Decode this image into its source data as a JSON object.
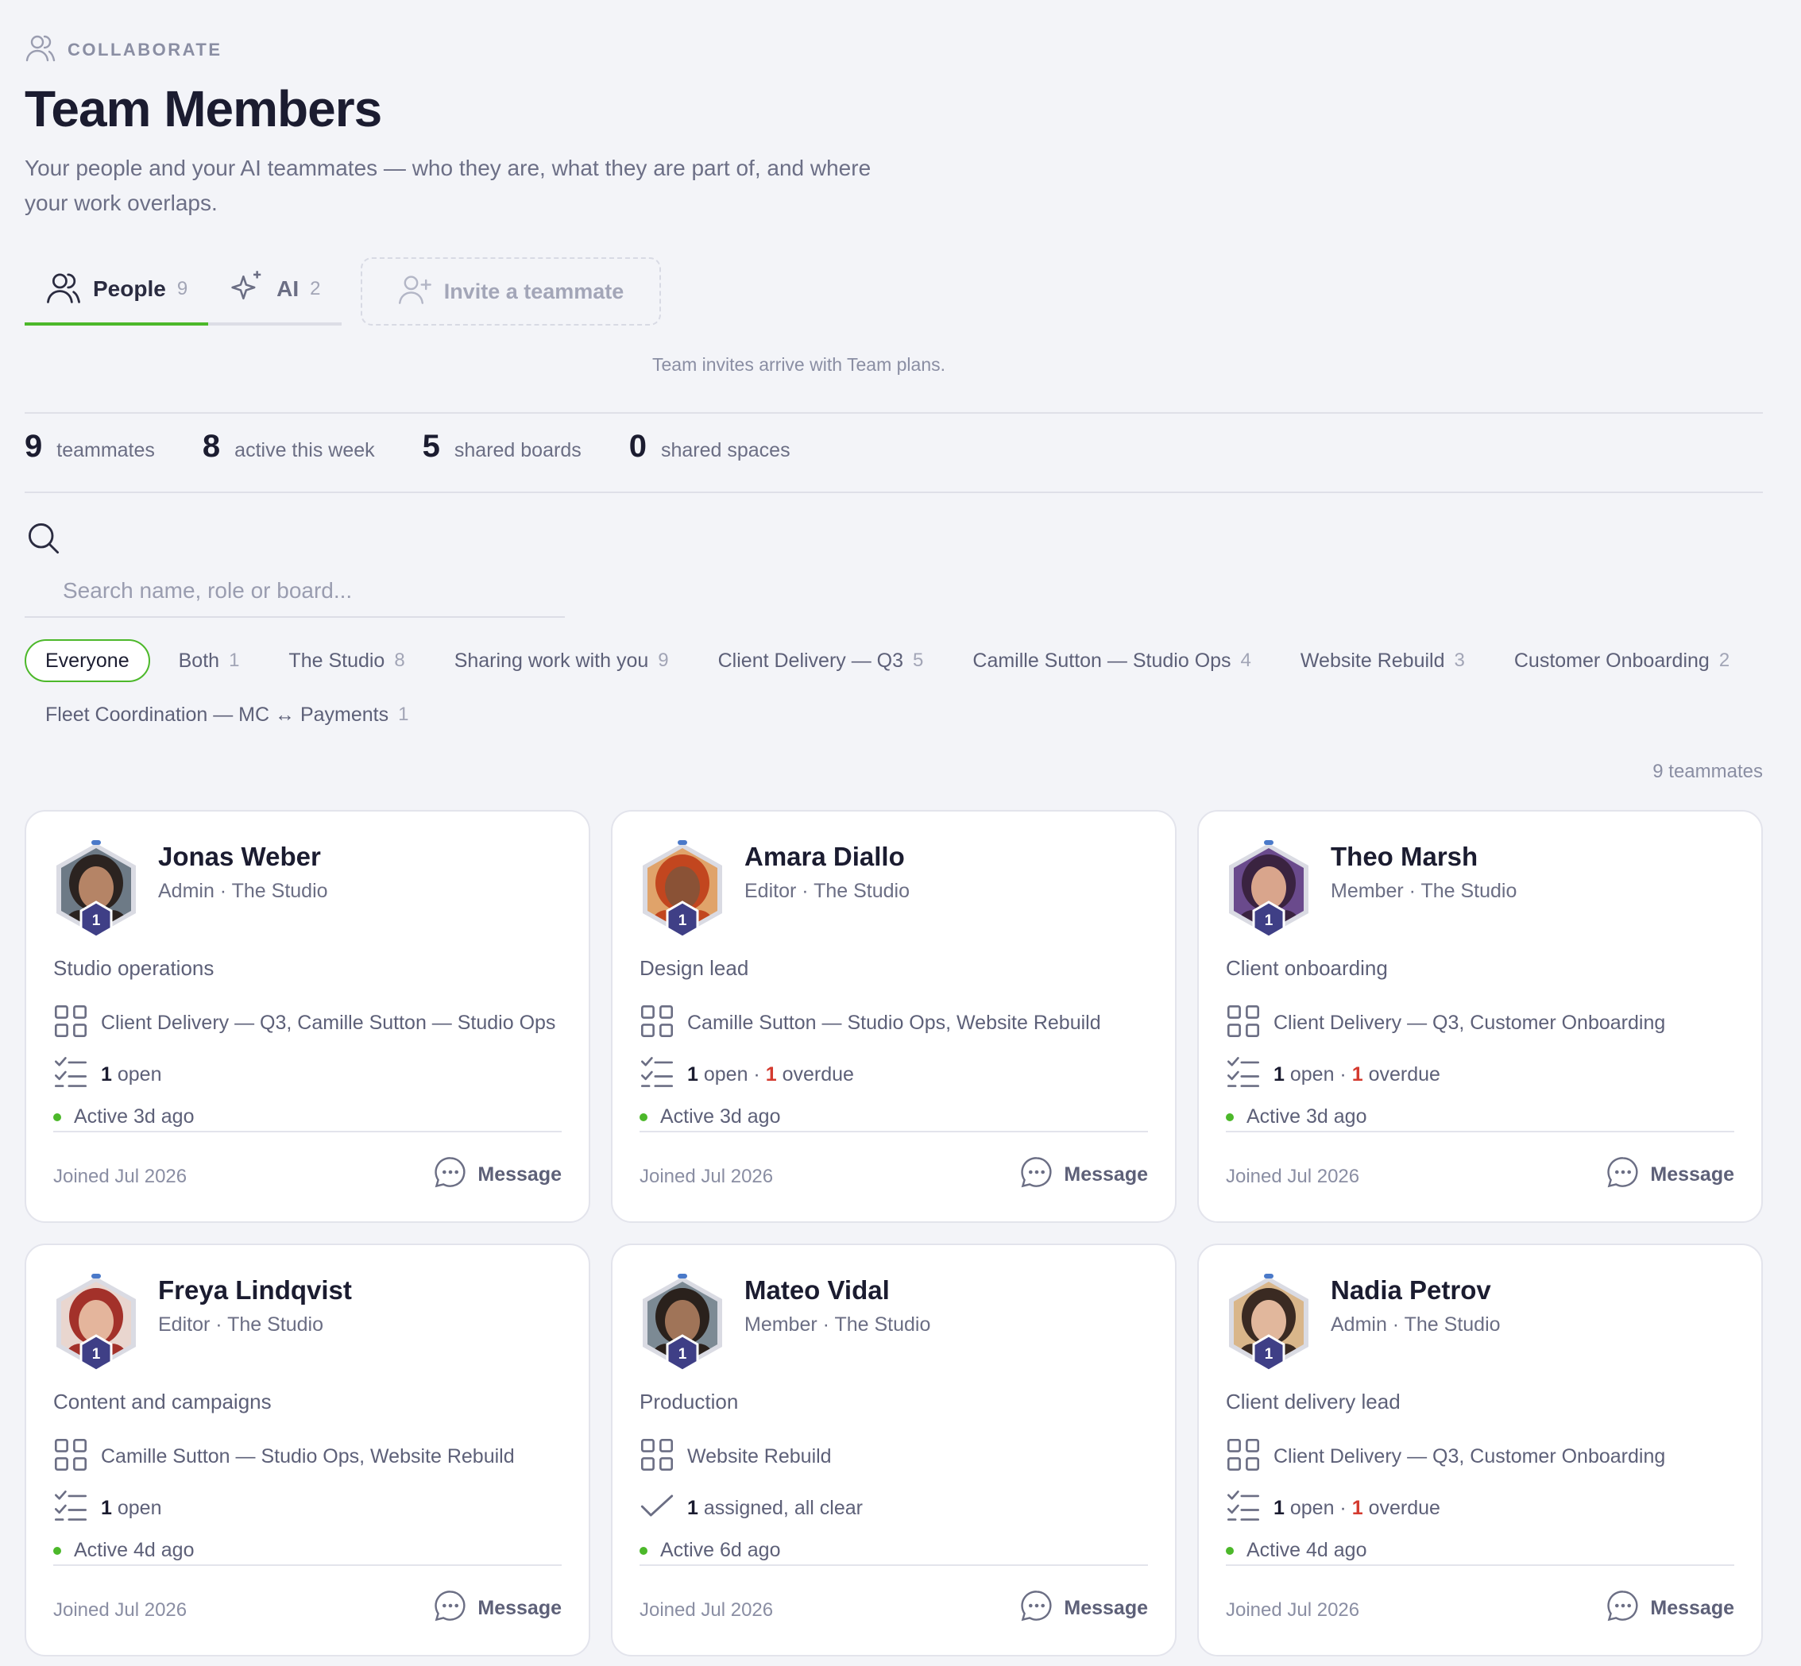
{
  "header": {
    "eyebrow": "COLLABORATE",
    "title": "Team Members",
    "subtitle": "Your people and your AI teammates — who they are, what they are part of, and where your work overlaps."
  },
  "tabs": [
    {
      "label": "People",
      "count": "9",
      "icon": "people-icon"
    },
    {
      "label": "AI",
      "count": "2",
      "icon": "sparkle-icon"
    }
  ],
  "invite": {
    "label": "Invite a teammate",
    "note": "Team invites arrive with Team plans."
  },
  "stats": [
    {
      "value": "9",
      "label": "teammates"
    },
    {
      "value": "8",
      "label": "active this week"
    },
    {
      "value": "5",
      "label": "shared boards"
    },
    {
      "value": "0",
      "label": "shared spaces"
    }
  ],
  "search": {
    "placeholder": "Search name, role or board..."
  },
  "filters": [
    {
      "label": "Everyone",
      "count": ""
    },
    {
      "label": "Both",
      "count": "1"
    },
    {
      "label": "The Studio",
      "count": "8"
    },
    {
      "label": "Sharing work with you",
      "count": "9"
    },
    {
      "label": "Client Delivery — Q3",
      "count": "5"
    },
    {
      "label": "Camille Sutton — Studio Ops",
      "count": "4"
    },
    {
      "label": "Website Rebuild",
      "count": "3"
    },
    {
      "label": "Customer Onboarding",
      "count": "2"
    },
    {
      "label": "Fleet Coordination — MC ↔ Payments",
      "count": "1"
    }
  ],
  "result_count": "9 teammates",
  "members": [
    {
      "name": "Jonas Weber",
      "role": "Admin · The Studio",
      "level": "1",
      "desc": "Studio operations",
      "boards": "Client Delivery — Q3, Camille Sutton — Studio Ops",
      "open": "1",
      "open_label": "open",
      "overdue": "",
      "overdue_label": "",
      "assigned_label": "",
      "active": "Active 3d ago",
      "joined": "Joined Jul 2026",
      "message": "Message",
      "hair": "#2b2320",
      "skin": "#b58466",
      "bg": "#6d7a86"
    },
    {
      "name": "Amara Diallo",
      "role": "Editor · The Studio",
      "level": "1",
      "desc": "Design lead",
      "boards": "Camille Sutton — Studio Ops, Website Rebuild",
      "open": "1",
      "open_label": "open ·",
      "overdue": "1",
      "overdue_label": "overdue",
      "assigned_label": "",
      "active": "Active 3d ago",
      "joined": "Joined Jul 2026",
      "message": "Message",
      "hair": "#c2461f",
      "skin": "#8a5236",
      "bg": "#e0a36a"
    },
    {
      "name": "Theo Marsh",
      "role": "Member · The Studio",
      "level": "1",
      "desc": "Client onboarding",
      "boards": "Client Delivery — Q3, Customer Onboarding",
      "open": "1",
      "open_label": "open ·",
      "overdue": "1",
      "overdue_label": "overdue",
      "assigned_label": "",
      "active": "Active 3d ago",
      "joined": "Joined Jul 2026",
      "message": "Message",
      "hair": "#3a2340",
      "skin": "#d9a58c",
      "bg": "#6a4a8c"
    },
    {
      "name": "Freya Lindqvist",
      "role": "Editor · The Studio",
      "level": "1",
      "desc": "Content and campaigns",
      "boards": "Camille Sutton — Studio Ops, Website Rebuild",
      "open": "1",
      "open_label": "open",
      "overdue": "",
      "overdue_label": "",
      "assigned_label": "",
      "active": "Active 4d ago",
      "joined": "Joined Jul 2026",
      "message": "Message",
      "hair": "#a3312a",
      "skin": "#e4b59c",
      "bg": "#e9d6cf"
    },
    {
      "name": "Mateo Vidal",
      "role": "Member · The Studio",
      "level": "1",
      "desc": "Production",
      "boards": "Website Rebuild",
      "open": "1",
      "open_label": "",
      "overdue": "",
      "overdue_label": "",
      "assigned_label": "assigned, all clear",
      "active": "Active 6d ago",
      "joined": "Joined Jul 2026",
      "message": "Message",
      "hair": "#2a211c",
      "skin": "#a07458",
      "bg": "#7c8a94"
    },
    {
      "name": "Nadia Petrov",
      "role": "Admin · The Studio",
      "level": "1",
      "desc": "Client delivery lead",
      "boards": "Client Delivery — Q3, Customer Onboarding",
      "open": "1",
      "open_label": "open ·",
      "overdue": "1",
      "overdue_label": "overdue",
      "assigned_label": "",
      "active": "Active 4d ago",
      "joined": "Joined Jul 2026",
      "message": "Message",
      "hair": "#3a2a22",
      "skin": "#e1b79c",
      "bg": "#d9b68a"
    }
  ],
  "colors": {
    "accent": "#4cb82a",
    "overdue": "#d43a2f",
    "badge": "#3f3f86",
    "avatar_ring": "#dadbe3"
  }
}
